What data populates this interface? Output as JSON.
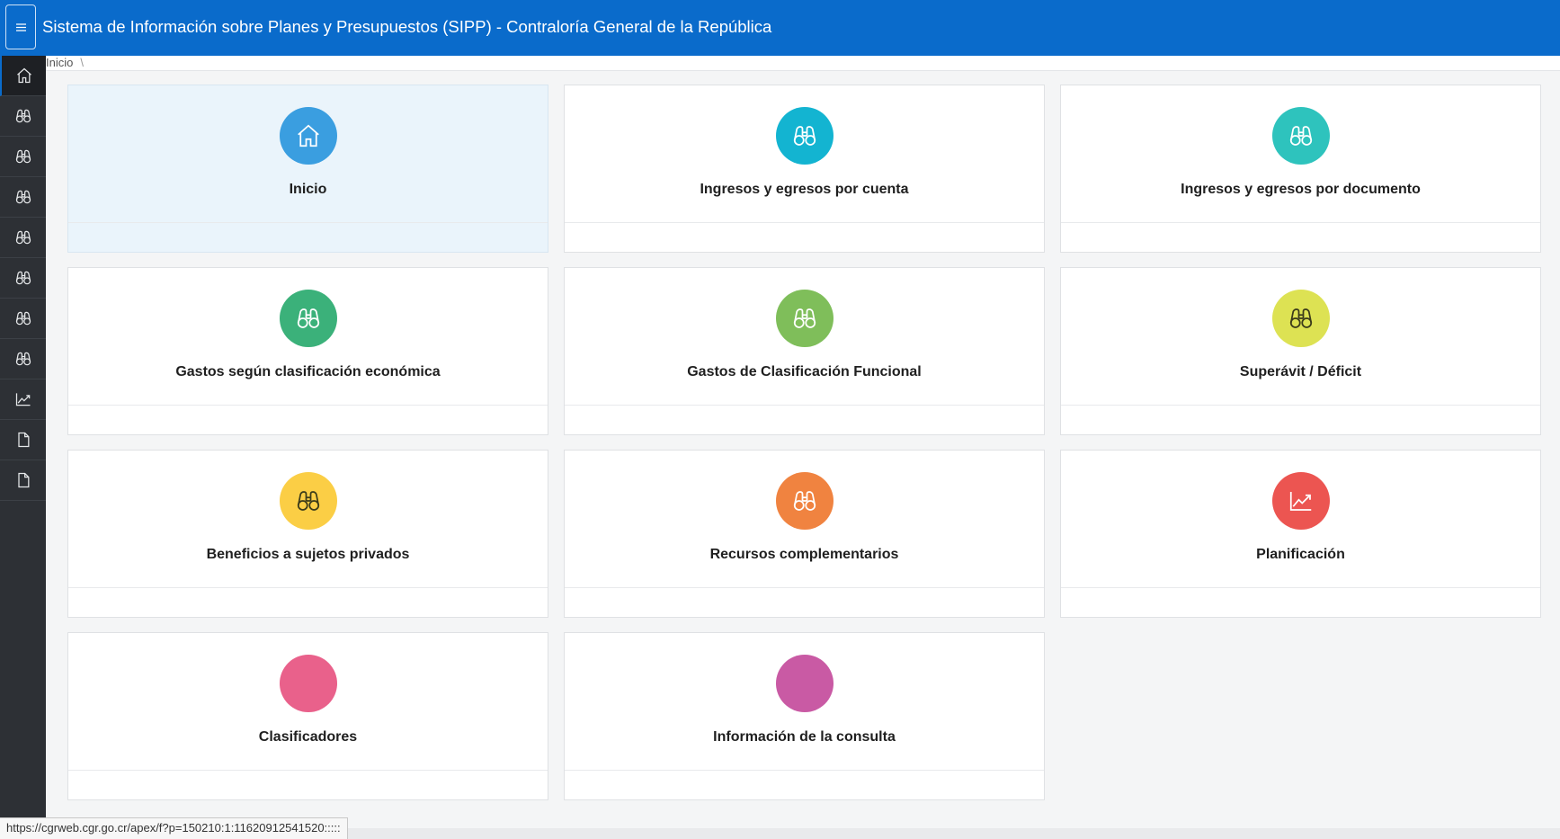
{
  "header": {
    "title": "Sistema de Información sobre Planes y Presupuestos (SIPP) - Contraloría General de la República",
    "menu_icon": "hamburger-icon"
  },
  "sidebar": {
    "items": [
      {
        "icon": "home-icon",
        "active": true
      },
      {
        "icon": "binoculars-icon"
      },
      {
        "icon": "binoculars-icon"
      },
      {
        "icon": "binoculars-icon"
      },
      {
        "icon": "binoculars-icon"
      },
      {
        "icon": "binoculars-icon"
      },
      {
        "icon": "binoculars-icon"
      },
      {
        "icon": "binoculars-icon"
      },
      {
        "icon": "line-chart-icon"
      },
      {
        "icon": "document-icon"
      },
      {
        "icon": "document-icon"
      }
    ]
  },
  "breadcrumb": {
    "current": "Inicio",
    "separator": "\\"
  },
  "cards": [
    {
      "label": "Inicio",
      "color": "#3a9ee0",
      "icon": "home-icon",
      "active": true
    },
    {
      "label": "Ingresos y egresos por cuenta",
      "color": "#13b4d1",
      "icon": "binoculars-icon"
    },
    {
      "label": "Ingresos y egresos por documento",
      "color": "#2ec3bd",
      "icon": "binoculars-icon"
    },
    {
      "label": "Gastos según clasificación económica",
      "color": "#3bb17a",
      "icon": "binoculars-icon"
    },
    {
      "label": "Gastos de Clasificación Funcional",
      "color": "#7fbe5a",
      "icon": "binoculars-icon"
    },
    {
      "label": "Superávit / Déficit",
      "color": "#dde253",
      "icon": "binoculars-icon"
    },
    {
      "label": "Beneficios a sujetos privados",
      "color": "#fbce45",
      "icon": "binoculars-icon"
    },
    {
      "label": "Recursos complementarios",
      "color": "#f08340",
      "icon": "binoculars-icon"
    },
    {
      "label": "Planificación",
      "color": "#ec5551",
      "icon": "line-chart-icon"
    },
    {
      "label": "Clasificadores",
      "color": "#e9618b",
      "icon": ""
    },
    {
      "label": "Información de la consulta",
      "color": "#c95aa4",
      "icon": ""
    }
  ],
  "status_bar": {
    "url": "https://cgrweb.cgr.go.cr/apex/f?p=150210:1:11620912541520:::::"
  }
}
